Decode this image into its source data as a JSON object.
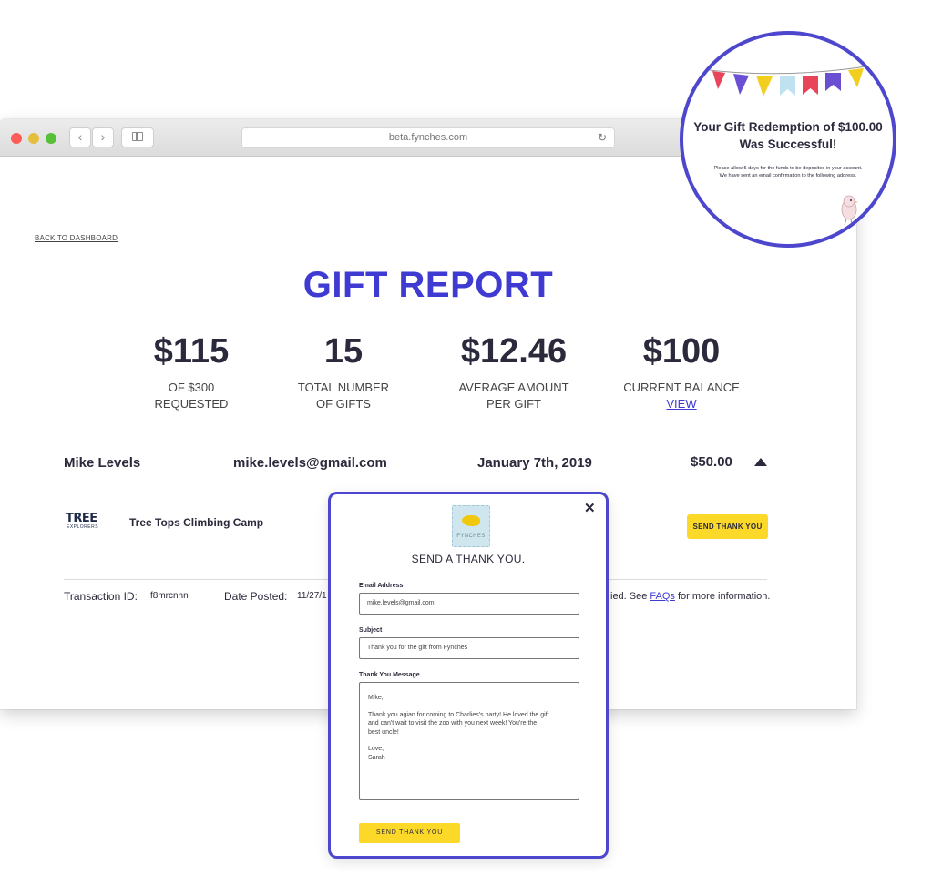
{
  "browser": {
    "url": "beta.fynches.com"
  },
  "page": {
    "back_link": "BACK TO DASHBOARD",
    "title": "GIFT REPORT"
  },
  "stats": [
    {
      "value": "$115",
      "label1": "OF $300",
      "label2": "REQUESTED"
    },
    {
      "value": "15",
      "label1": "TOTAL NUMBER",
      "label2": "OF GIFTS"
    },
    {
      "value": "$12.46",
      "label1": "AVERAGE AMOUNT",
      "label2": "PER GIFT"
    },
    {
      "value": "$100",
      "label1": "CURRENT BALANCE",
      "link": "VIEW"
    }
  ],
  "gift_row": {
    "name": "Mike Levels",
    "email": "mike.levels@gmail.com",
    "date": "January 7th, 2019",
    "amount": "$50.00",
    "vendor_logo_text": "TREE",
    "vendor_logo_sub": "EXPLORERS",
    "vendor_name": "Tree Tops Climbing Camp",
    "send_button": "SEND THANK YOU",
    "transaction_label": "Transaction ID:",
    "transaction_value": "f8mrcnnn",
    "date_posted_label": "Date Posted:",
    "date_posted_value": "11/27/1",
    "faq_prefix": "ied. See ",
    "faq_link": "FAQs",
    "faq_suffix": " for more information."
  },
  "modal": {
    "close": "✕",
    "logo_brand": "FYNCHES",
    "title": "SEND A THANK YOU.",
    "email_label": "Email Address",
    "email_value": "mike.levels@gmail.com",
    "subject_label": "Subject",
    "subject_value": "Thank you for the gift from Fynches",
    "message_label": "Thank You Message",
    "message_greeting": "Mike,",
    "message_body": "Thank you agian for coming to Charlies's party! He loved the gift and can't wait to visit the zoo with you next week! You're the best uncle!",
    "message_signoff": "Love,",
    "message_name": "Sarah",
    "send_button": "SEND THANK YOU"
  },
  "success_popup": {
    "title_line1": "Your Gift Redemption of $100.00",
    "title_line2": "Was Successful!",
    "note_line1": "Please allow 5 days for the funds to be deposited in your account.",
    "note_line2": "We have sent an email confirmation to the following address."
  },
  "colors": {
    "brand_blue": "#3e3ad2",
    "accent_yellow": "#fcd928",
    "modal_border": "#4d47cd"
  }
}
